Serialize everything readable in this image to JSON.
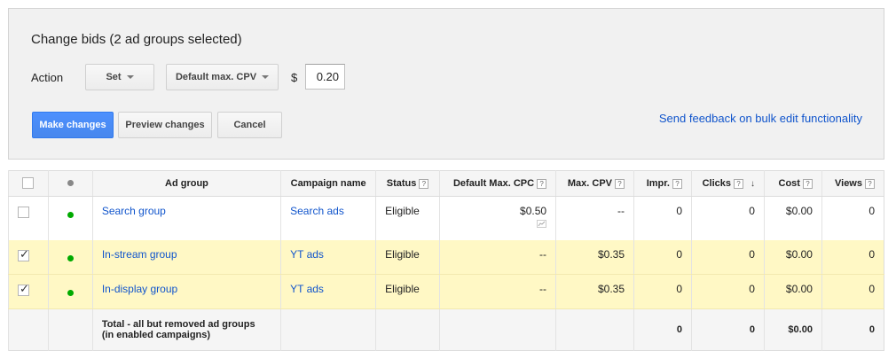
{
  "panel": {
    "title": "Change bids (2 ad groups selected)",
    "action_label": "Action",
    "action_select": "Set",
    "bid_type_select": "Default max. CPV",
    "currency_symbol": "$",
    "bid_value": "0.20",
    "make_changes_label": "Make changes",
    "preview_changes_label": "Preview changes",
    "cancel_label": "Cancel",
    "feedback_link": "Send feedback on bulk edit functionality"
  },
  "table": {
    "headers": {
      "ad_group": "Ad group",
      "campaign": "Campaign name",
      "status": "Status",
      "default_max_cpc": "Default Max. CPC",
      "max_cpv": "Max. CPV",
      "impr": "Impr.",
      "clicks": "Clicks",
      "cost": "Cost",
      "views": "Views",
      "help": "?"
    },
    "rows": [
      {
        "selected": false,
        "ad_group": "Search group",
        "campaign": "Search ads",
        "status": "Eligible",
        "default_max_cpc": "$0.50",
        "max_cpv": "--",
        "impr": "0",
        "clicks": "0",
        "cost": "$0.00",
        "views": "0"
      },
      {
        "selected": true,
        "ad_group": "In-stream group",
        "campaign": "YT ads",
        "status": "Eligible",
        "default_max_cpc": "--",
        "max_cpv": "$0.35",
        "impr": "0",
        "clicks": "0",
        "cost": "$0.00",
        "views": "0"
      },
      {
        "selected": true,
        "ad_group": "In-display group",
        "campaign": "YT ads",
        "status": "Eligible",
        "default_max_cpc": "--",
        "max_cpv": "$0.35",
        "impr": "0",
        "clicks": "0",
        "cost": "$0.00",
        "views": "0"
      }
    ],
    "total": {
      "label_line1": "Total - all but removed ad groups",
      "label_line2": "(in enabled campaigns)",
      "impr": "0",
      "clicks": "0",
      "cost": "$0.00",
      "views": "0"
    }
  },
  "colors": {
    "accent_blue": "#4d90fe",
    "link": "#1155cc",
    "selected_row": "#fff8c5",
    "status_dot": "#00aa00"
  },
  "icons": {
    "sort": "arrow-down-icon",
    "status": "status-dot-icon",
    "chart": "mini-chart-icon",
    "help": "help-icon"
  }
}
